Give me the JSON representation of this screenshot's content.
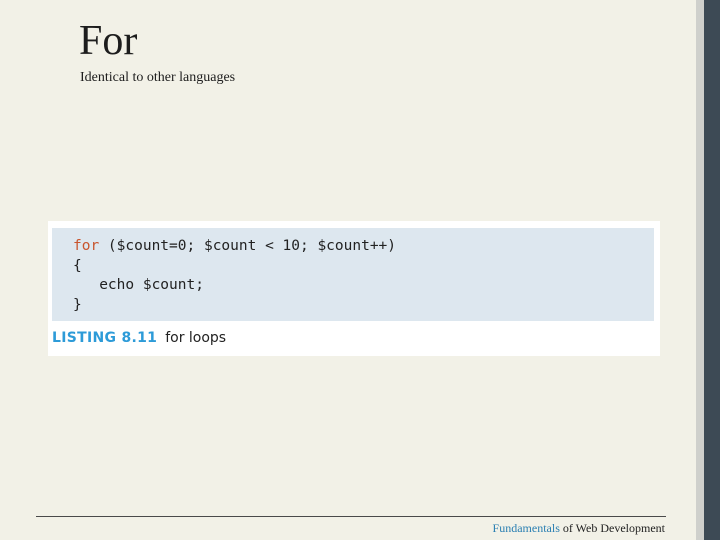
{
  "slide": {
    "title": "For",
    "subtitle": "Identical to other languages"
  },
  "listing": {
    "code_lines": [
      {
        "keyword": "for",
        "rest": " ($count=0; $count < 10; $count++)"
      },
      {
        "keyword": "",
        "rest": "{"
      },
      {
        "keyword": "",
        "rest": "   echo $count;"
      },
      {
        "keyword": "",
        "rest": "}"
      }
    ],
    "number": "LISTING 8.11",
    "caption": "for loops"
  },
  "footer": {
    "accent_text": "Fundamentals",
    "rest_text": " of Web Development"
  },
  "colors": {
    "background": "#f2f1e7",
    "code_background": "#dde7ef",
    "keyword": "#c8552e",
    "listing_number": "#2d9bd8",
    "footer_accent": "#2a7fb2"
  }
}
